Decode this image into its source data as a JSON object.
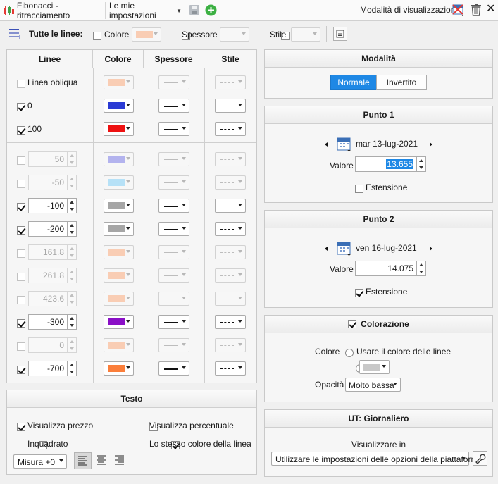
{
  "topbar": {
    "title": "Fibonacci - ritracciamento",
    "settings_preset": "Le mie impostazioni",
    "view_mode_label": "Modalità di visualizzazione"
  },
  "all_lines": {
    "label": "Tutte le linee:",
    "color_label": "Colore",
    "thickness_label": "Spessore",
    "style_label": "Stile",
    "color": "#f9cdb4"
  },
  "lines_table": {
    "headers": [
      "Linee",
      "Colore",
      "Spessore",
      "Stile"
    ],
    "top_rows": [
      {
        "label": "Linea obliqua",
        "checked": false,
        "color": "#f9cdb4",
        "enabled": false
      },
      {
        "label": "0",
        "checked": true,
        "color": "#2b3bd4",
        "enabled": true
      },
      {
        "label": "100",
        "checked": true,
        "color": "#ee1111",
        "enabled": true
      }
    ],
    "level_rows": [
      {
        "value": "50",
        "checked": false,
        "color": "#b3b3ee",
        "enabled": false
      },
      {
        "value": "-50",
        "checked": false,
        "color": "#b6e1f7",
        "enabled": false
      },
      {
        "value": "-100",
        "checked": true,
        "color": "#a6a6a6",
        "enabled": true
      },
      {
        "value": "-200",
        "checked": true,
        "color": "#a6a6a6",
        "enabled": true
      },
      {
        "value": "161.8",
        "checked": false,
        "color": "#f9cdb4",
        "enabled": false
      },
      {
        "value": "261.8",
        "checked": false,
        "color": "#f9cdb4",
        "enabled": false
      },
      {
        "value": "423.6",
        "checked": false,
        "color": "#f9cdb4",
        "enabled": false
      },
      {
        "value": "-300",
        "checked": true,
        "color": "#8a0fc6",
        "enabled": true
      },
      {
        "value": "0",
        "checked": false,
        "color": "#f9cdb4",
        "enabled": false
      },
      {
        "value": "-700",
        "checked": true,
        "color": "#fb7e3a",
        "enabled": true
      }
    ]
  },
  "text_panel": {
    "title": "Testo",
    "show_price": "Visualizza prezzo",
    "show_price_checked": true,
    "show_percent": "Visualizza percentuale",
    "show_percent_checked": false,
    "framed": "Inquadrato",
    "framed_checked": false,
    "same_color": "Lo stesso colore della linea",
    "same_color_checked": true,
    "size": "Misura +0"
  },
  "mode_panel": {
    "title": "Modalità",
    "normal": "Normale",
    "inverted": "Invertito",
    "active": "Normale"
  },
  "point1": {
    "title": "Punto 1",
    "date": "mar 13-lug-2021",
    "value_label": "Valore",
    "value": "13.655",
    "extension_label": "Estensione",
    "extension_checked": false
  },
  "point2": {
    "title": "Punto 2",
    "date": "ven 16-lug-2021",
    "value_label": "Valore",
    "value": "14.075",
    "extension_label": "Estensione",
    "extension_checked": true
  },
  "coloring": {
    "title": "Colorazione",
    "checked": true,
    "color_label": "Colore",
    "use_line_color": "Usare il colore delle linee",
    "custom_color": "#c8c8c8",
    "opacity_label": "Opacità",
    "opacity": "Molto bassa"
  },
  "timeframe": {
    "title": "UT: Giornaliero",
    "show_in_label": "Visualizzare in",
    "option": "Utilizzare le impostazioni delle opzioni della piattaforma"
  },
  "colors": {
    "accent": "#1e88e5",
    "add_green": "#3cb043"
  }
}
